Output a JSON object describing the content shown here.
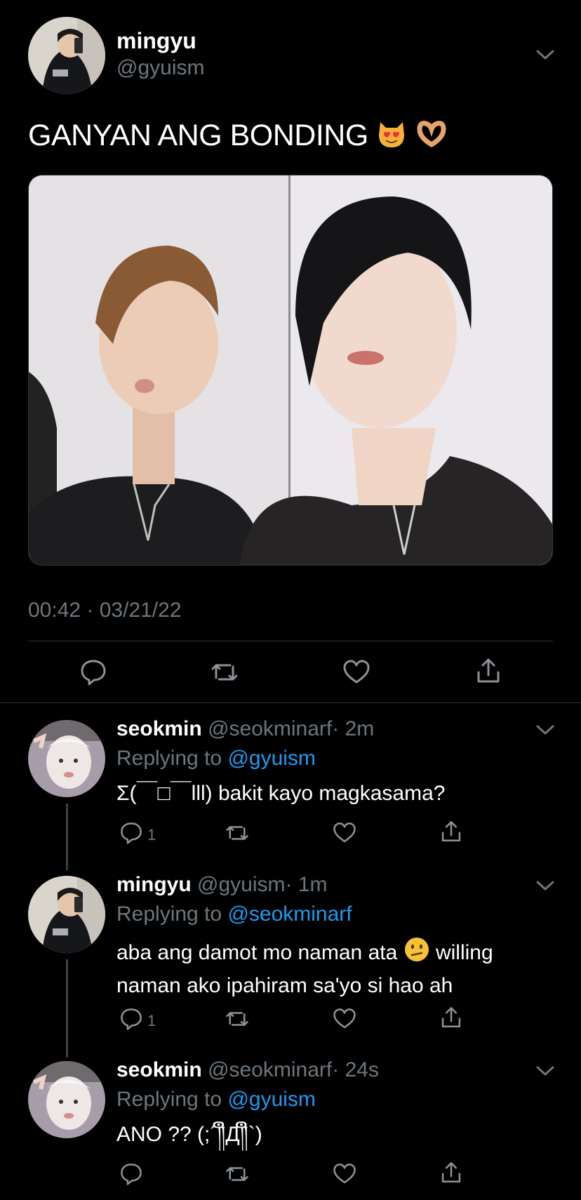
{
  "main_tweet": {
    "name": "mingyu",
    "handle": "@gyuism",
    "text": "GANYAN ANG BONDING",
    "emojis": [
      "heart-eyes-cat-emoji",
      "heart-hands-emoji"
    ],
    "timestamp": "00:42 · 03/21/22"
  },
  "replies": [
    {
      "name": "seokmin",
      "handle": "@seokminarf",
      "time": "· 2m",
      "replying_prefix": "Replying to",
      "replying_to": "@gyuism",
      "text": "Σ(￣□￣lll) bakit kayo magkasama?",
      "reply_count": "1"
    },
    {
      "name": "mingyu",
      "handle": "@gyuism",
      "time": "· 1m",
      "replying_prefix": "Replying to",
      "replying_to": "@seokminarf",
      "text_line1": "aba ang damot mo naman ata",
      "text_line1_after": "willing",
      "text_line2": "naman ako ipahiram sa'yo si hao ah",
      "reply_count": "1"
    },
    {
      "name": "seokmin",
      "handle": "@seokminarf",
      "time": "· 24s",
      "replying_prefix": "Replying to",
      "replying_to": "@gyuism",
      "text": "ANO ?? (;´༎ຶД༎ຶ`)"
    }
  ],
  "colors": {
    "background": "#000000",
    "muted": "#6e767d",
    "link": "#1d9bf0",
    "divider": "#2f3336"
  }
}
